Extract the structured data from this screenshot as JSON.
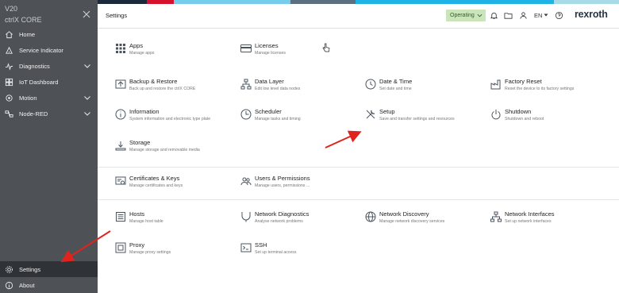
{
  "sidebar": {
    "version": "V20",
    "product": "ctrlX CORE",
    "items": [
      {
        "label": "Home",
        "icon": "home-icon"
      },
      {
        "label": "Service Indicator",
        "icon": "service-indicator-icon"
      },
      {
        "label": "Diagnostics",
        "icon": "diagnostics-icon"
      },
      {
        "label": "IoT Dashboard",
        "icon": "dashboard-icon"
      },
      {
        "label": "Motion",
        "icon": "motion-icon"
      },
      {
        "label": "Node-RED",
        "icon": "node-red-icon"
      }
    ],
    "settings_label": "Settings",
    "about_label": "About"
  },
  "topbar": {
    "title": "Settings",
    "operating_label": "Operating",
    "lang_label": "EN",
    "brand": "rexroth"
  },
  "colors": {
    "sidebar_bg": "#4e5257",
    "operating_bg": "#c9e5b9",
    "arrow": "#e0231c",
    "strip": [
      "#1b2a3a",
      "#d4122b",
      "#2c3e50",
      "#76cdeb",
      "#5c7080",
      "#1fb2e6",
      "#a7dbe8"
    ]
  },
  "tiles": [
    {
      "name": "Apps",
      "desc": "Manage apps",
      "icon": "apps-icon"
    },
    {
      "name": "Licenses",
      "desc": "Manage licenses",
      "icon": "license-card-icon"
    },
    {
      "name": "Backup & Restore",
      "desc": "Back up and restore the ctrlX CORE",
      "icon": "backup-icon"
    },
    {
      "name": "Data Layer",
      "desc": "Edit low level data nodes",
      "icon": "data-layer-icon"
    },
    {
      "name": "Date & Time",
      "desc": "Set date and time",
      "icon": "clock-icon"
    },
    {
      "name": "Factory Reset",
      "desc": "Reset the device to its factory settings",
      "icon": "factory-reset-icon"
    },
    {
      "name": "Information",
      "desc": "System information and electronic type plate",
      "icon": "info-icon"
    },
    {
      "name": "Scheduler",
      "desc": "Manage tasks and timing",
      "icon": "scheduler-icon"
    },
    {
      "name": "Setup",
      "desc": "Save and transfer settings and resources",
      "icon": "setup-tools-icon"
    },
    {
      "name": "Shutdown",
      "desc": "Shutdown and reboot",
      "icon": "power-icon"
    },
    {
      "name": "Storage",
      "desc": "Manage storage and removable media",
      "icon": "storage-icon"
    },
    {
      "name": "Certificates & Keys",
      "desc": "Manage certificates and keys",
      "icon": "certificate-icon"
    },
    {
      "name": "Users & Permissions",
      "desc": "Manage users, permissions ...",
      "icon": "users-icon"
    },
    {
      "name": "Hosts",
      "desc": "Manage host table",
      "icon": "hosts-icon"
    },
    {
      "name": "Network Diagnostics",
      "desc": "Analyse network problems",
      "icon": "network-diagnostics-icon"
    },
    {
      "name": "Network Discovery",
      "desc": "Manage network discovery services",
      "icon": "globe-icon"
    },
    {
      "name": "Network Interfaces",
      "desc": "Set up network interfaces",
      "icon": "network-interfaces-icon"
    },
    {
      "name": "Proxy",
      "desc": "Manage proxy settings",
      "icon": "proxy-icon"
    },
    {
      "name": "SSH",
      "desc": "Set up terminal access",
      "icon": "terminal-icon"
    }
  ]
}
